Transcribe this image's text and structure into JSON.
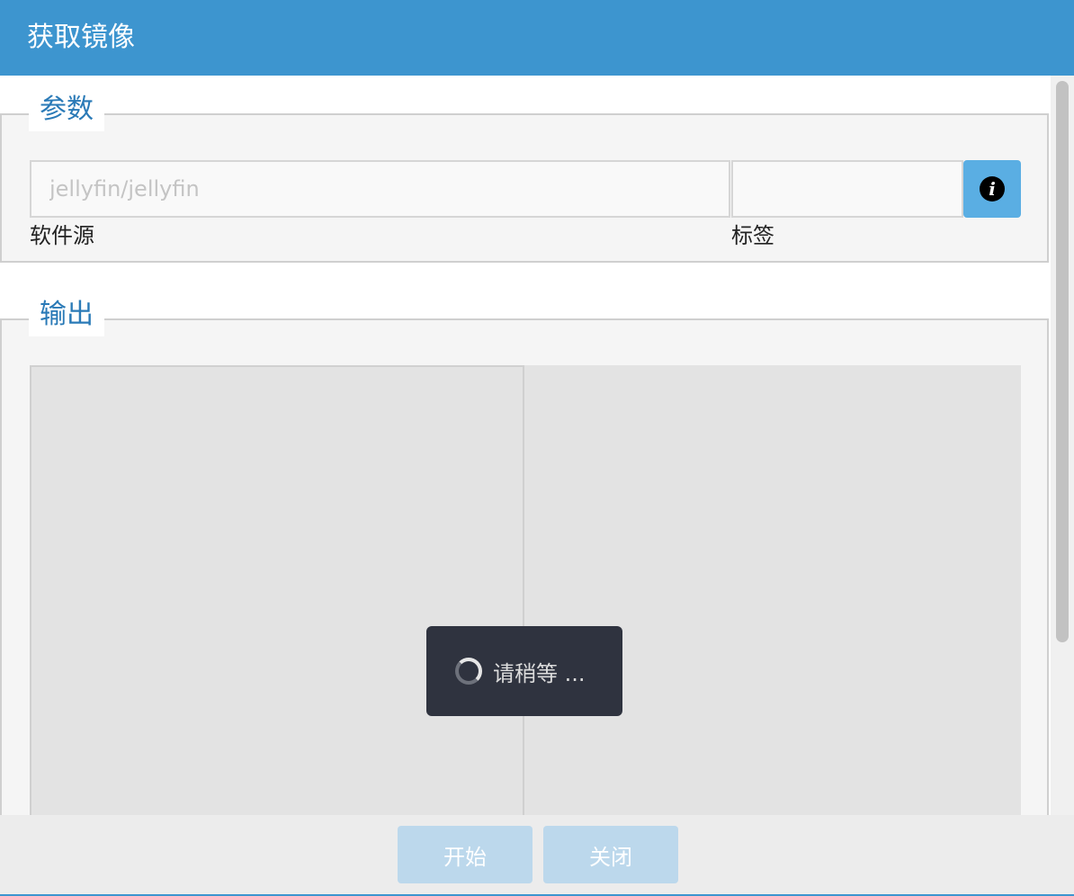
{
  "dialog": {
    "title": "获取镜像"
  },
  "params": {
    "legend": "参数",
    "repo": {
      "placeholder": "jellyfin/jellyfin",
      "value": "",
      "label": "软件源"
    },
    "tag": {
      "value": "",
      "label": "标签"
    },
    "info_icon": "info-icon"
  },
  "output": {
    "legend": "输出"
  },
  "footer": {
    "start_label": "开始",
    "close_label": "关闭"
  },
  "toast": {
    "text": "请稍等 ..."
  },
  "colors": {
    "titlebar": "#3d95cf",
    "legend_text": "#2a7ab7",
    "info_button": "#5aaee3",
    "disabled_button": "#bcd8ec",
    "toast_bg": "#2f333f"
  }
}
